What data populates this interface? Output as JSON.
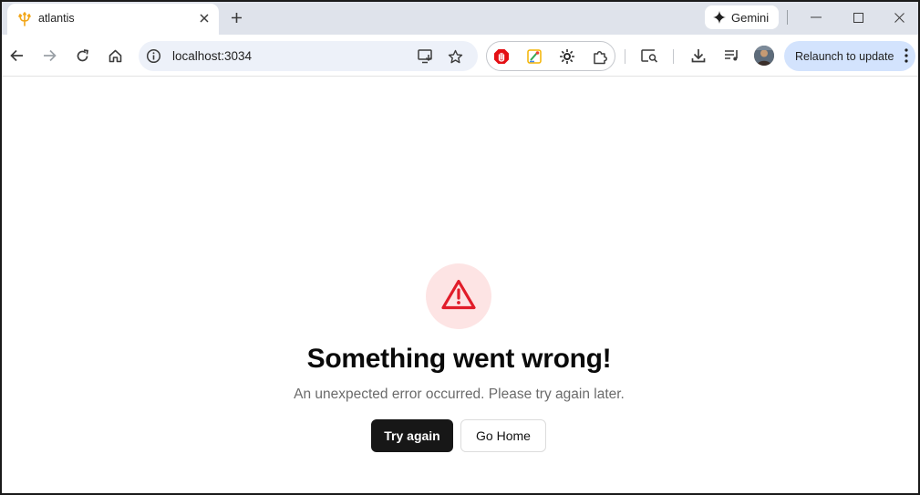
{
  "browser": {
    "tab": {
      "title": "atlantis",
      "favicon": "trident-icon"
    },
    "gemini_label": "Gemini",
    "url": "localhost:3034",
    "relaunch_label": "Relaunch to update",
    "accent_color": "#d3e3fd",
    "tabstrip_color": "#dfe3eb",
    "toolbar_icons": [
      "back-arrow-icon",
      "forward-arrow-icon",
      "reload-icon",
      "home-icon",
      "site-info-icon",
      "install-app-icon",
      "bookmark-star-icon",
      "adblock-hand-icon",
      "color-picker-icon",
      "sun-extension-icon",
      "extensions-puzzle-icon",
      "search-tabs-icon",
      "download-icon",
      "media-queue-icon",
      "profile-avatar",
      "more-menu-icon"
    ]
  },
  "page": {
    "icon": "warning-triangle-icon",
    "icon_color": "#e11d2a",
    "icon_bg": "#fde4e4",
    "title": "Something went wrong!",
    "description": "An unexpected error occurred. Please try again later.",
    "primary_button": "Try again",
    "secondary_button": "Go Home"
  }
}
